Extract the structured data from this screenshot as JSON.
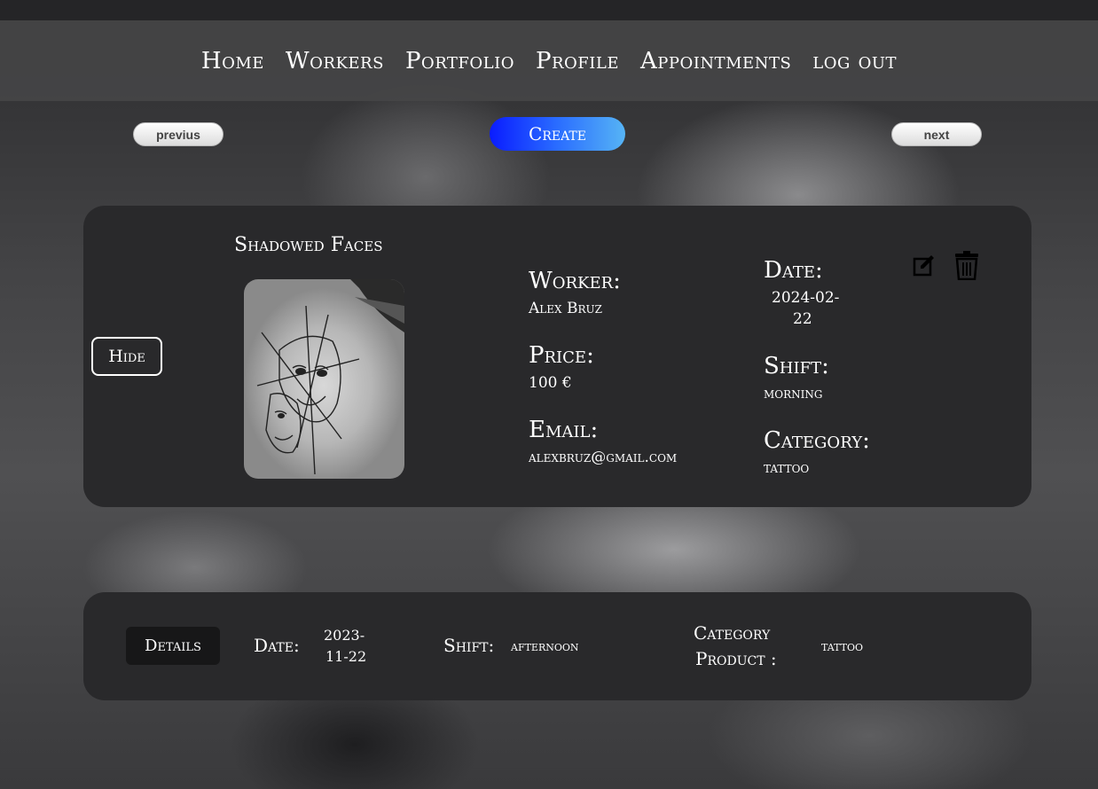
{
  "nav": {
    "items": [
      "Home",
      "Workers",
      "Portfolio",
      "Profile",
      "Appointments",
      "log out"
    ]
  },
  "pager": {
    "prev_label": "previus",
    "create_label": "Create",
    "next_label": "next"
  },
  "card": {
    "hide_label": "Hide",
    "title": "Shadowed Faces",
    "worker_label": "Worker:",
    "worker_value": "Alex Bruz",
    "price_label": "Price:",
    "price_value": "100 €",
    "email_label": "Email:",
    "email_value": "alexbruz@gmail.com",
    "date_label": "Date:",
    "date_value_line1": "2024-02-",
    "date_value_line2": "22",
    "shift_label": "Shift:",
    "shift_value": "morning",
    "category_label": "Category:",
    "category_value": "tattoo",
    "edit_icon": "edit-icon",
    "delete_icon": "trash-icon"
  },
  "card2": {
    "details_label": "Details",
    "date_label": "Date:",
    "date_value_line1": "2023-",
    "date_value_line2": "11-22",
    "shift_label": "Shift:",
    "shift_value": "afternoon",
    "category_label_line1": "Category",
    "category_label_line2": "Product :",
    "category_value": "tattoo"
  }
}
